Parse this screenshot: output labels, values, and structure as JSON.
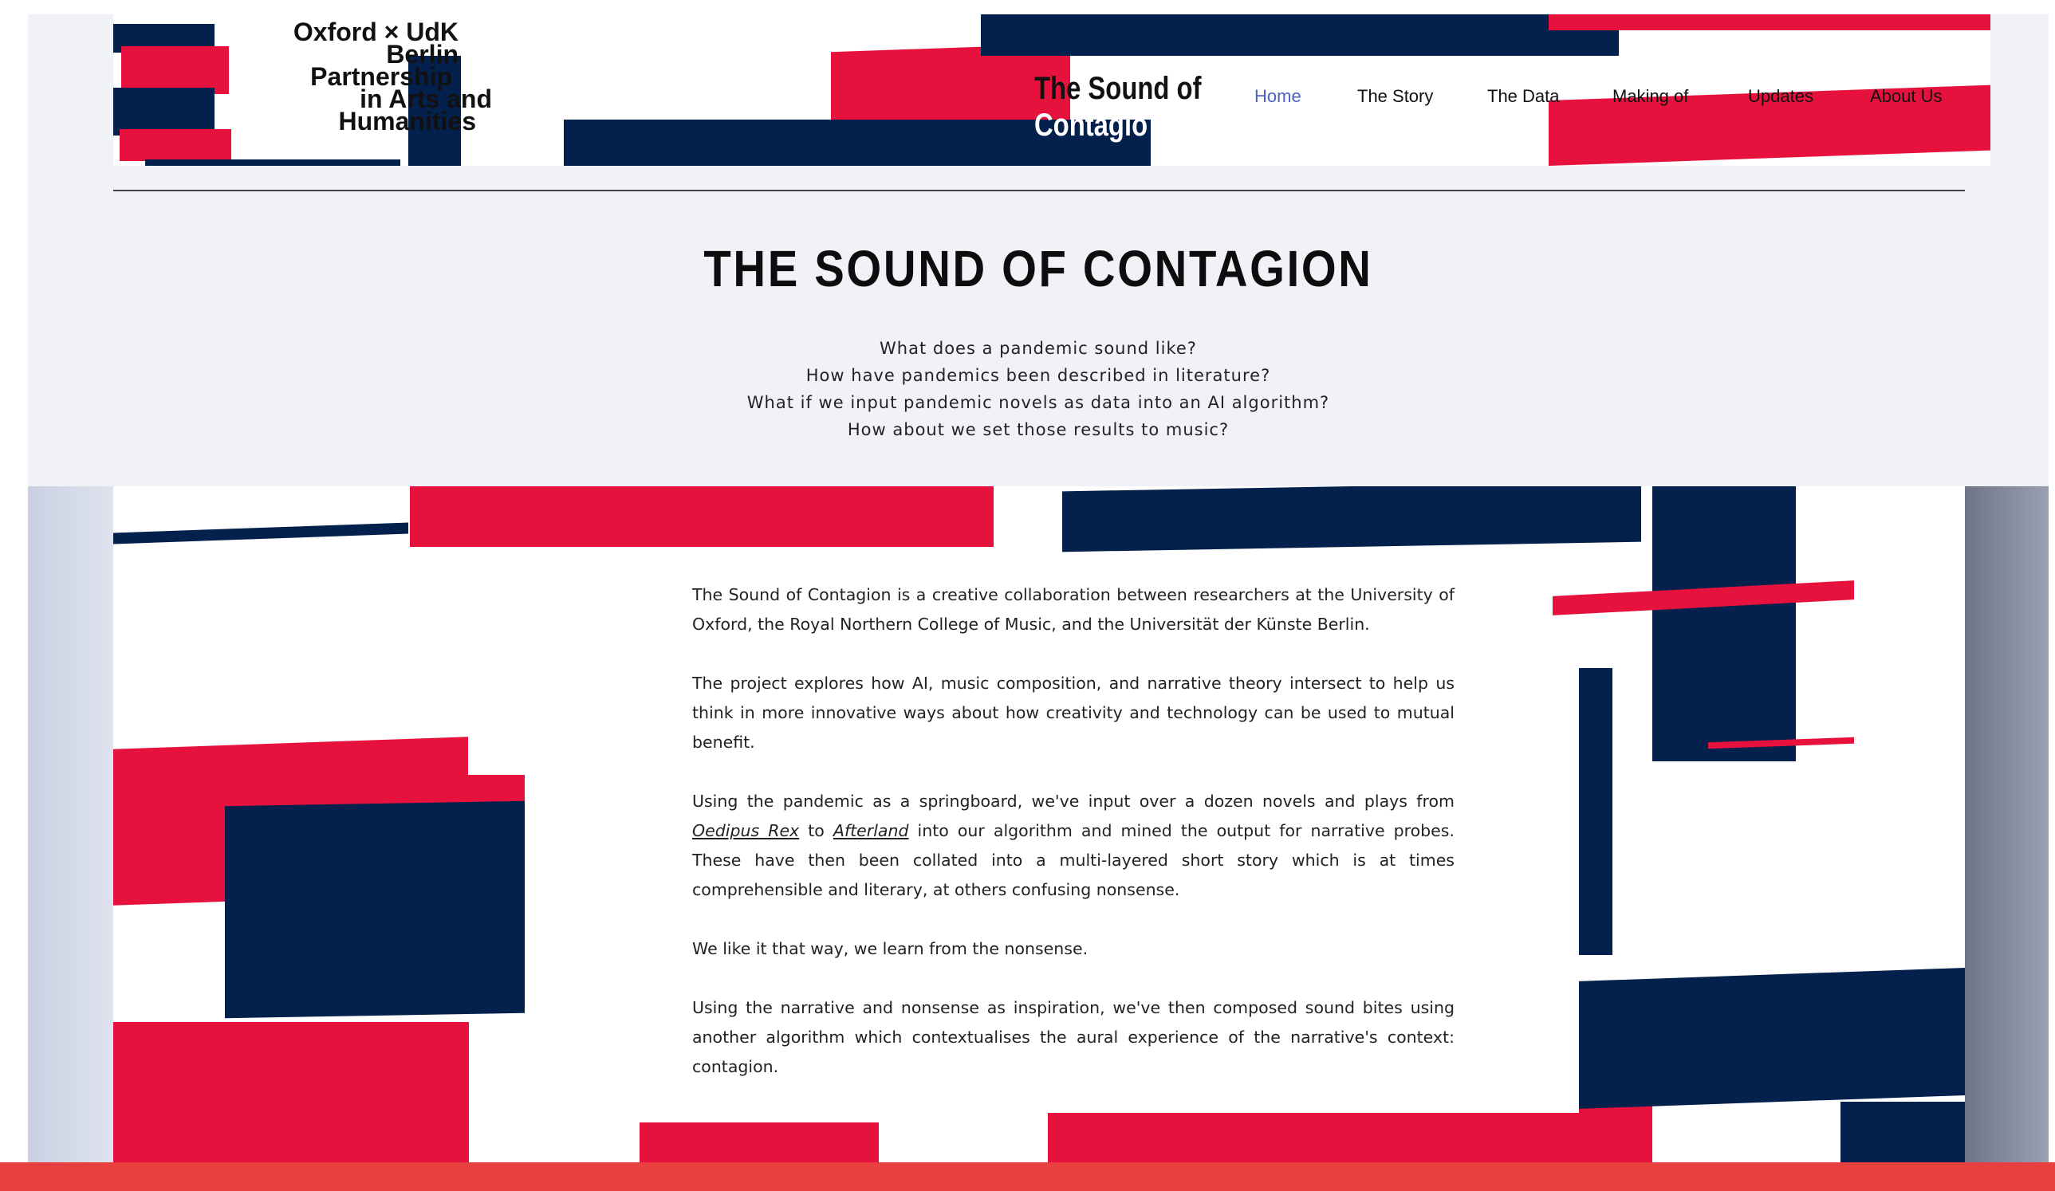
{
  "logo": {
    "lines": [
      "Oxford × UdK",
      "Berlin",
      "Partnership",
      "in Arts and",
      "Humanities"
    ]
  },
  "site_title": {
    "line1": "The Sound of",
    "line2": "Contagio"
  },
  "nav": {
    "items": [
      {
        "label": "Home",
        "active": true
      },
      {
        "label": "The Story"
      },
      {
        "label": "The Data"
      },
      {
        "label": "Making of"
      },
      {
        "label": "Updates"
      },
      {
        "label": "About Us"
      }
    ]
  },
  "hero": {
    "title": "THE SOUND OF CONTAGION",
    "questions": [
      "What does a pandemic sound like?",
      "How have pandemics been described in literature?",
      "What if we input pandemic novels as data into an AI algorithm?",
      "How about we set those results to music?"
    ]
  },
  "content": {
    "p1": "The Sound of Contagion is a creative collaboration between researchers at the University of Oxford, the Royal Northern College of Music, and the Universität der Künste Berlin.",
    "p2": "The project explores how AI, music composition, and narrative theory intersect to help us think in more innovative ways about how creativity and technology can be used to mutual benefit.",
    "p3_a": "Using the pandemic as a springboard, we've input over a dozen novels and plays from ",
    "p3_link1": "Oedipus Rex",
    "p3_b": " to ",
    "p3_link2": "Afterland",
    "p3_c": " into our algorithm and mined the output for narrative probes. These have then been collated into a multi-layered short story which is at times comprehensible and literary, at others confusing nonsense.",
    "p4": "We like it that way, we learn from the nonsense.",
    "p5": "Using the narrative and nonsense as inspiration, we've then composed sound bites using another algorithm which contextualises the aural experience of the narrative's context: contagion."
  },
  "colors": {
    "navy": "#04204c",
    "red": "#e6123d",
    "nav_active": "#4a63c8",
    "bottom_bar": "#e8403f"
  }
}
